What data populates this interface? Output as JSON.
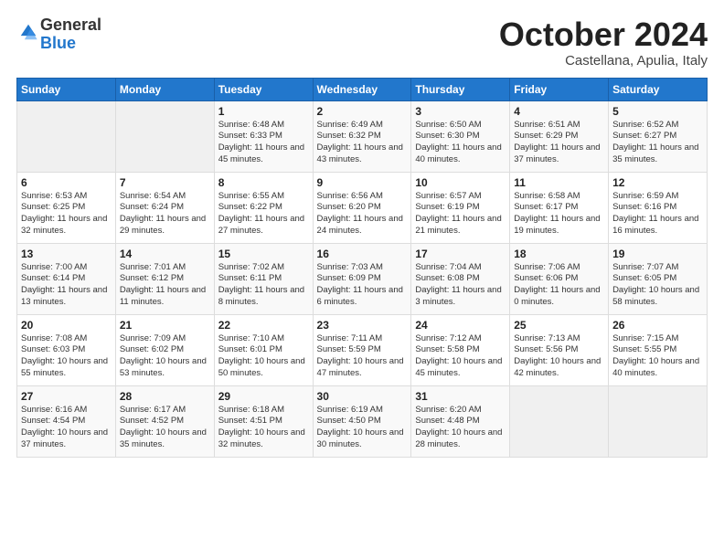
{
  "logo": {
    "general": "General",
    "blue": "Blue"
  },
  "title": "October 2024",
  "subtitle": "Castellana, Apulia, Italy",
  "header_days": [
    "Sunday",
    "Monday",
    "Tuesday",
    "Wednesday",
    "Thursday",
    "Friday",
    "Saturday"
  ],
  "weeks": [
    [
      {
        "day": "",
        "info": ""
      },
      {
        "day": "",
        "info": ""
      },
      {
        "day": "1",
        "info": "Sunrise: 6:48 AM\nSunset: 6:33 PM\nDaylight: 11 hours and 45 minutes."
      },
      {
        "day": "2",
        "info": "Sunrise: 6:49 AM\nSunset: 6:32 PM\nDaylight: 11 hours and 43 minutes."
      },
      {
        "day": "3",
        "info": "Sunrise: 6:50 AM\nSunset: 6:30 PM\nDaylight: 11 hours and 40 minutes."
      },
      {
        "day": "4",
        "info": "Sunrise: 6:51 AM\nSunset: 6:29 PM\nDaylight: 11 hours and 37 minutes."
      },
      {
        "day": "5",
        "info": "Sunrise: 6:52 AM\nSunset: 6:27 PM\nDaylight: 11 hours and 35 minutes."
      }
    ],
    [
      {
        "day": "6",
        "info": "Sunrise: 6:53 AM\nSunset: 6:25 PM\nDaylight: 11 hours and 32 minutes."
      },
      {
        "day": "7",
        "info": "Sunrise: 6:54 AM\nSunset: 6:24 PM\nDaylight: 11 hours and 29 minutes."
      },
      {
        "day": "8",
        "info": "Sunrise: 6:55 AM\nSunset: 6:22 PM\nDaylight: 11 hours and 27 minutes."
      },
      {
        "day": "9",
        "info": "Sunrise: 6:56 AM\nSunset: 6:20 PM\nDaylight: 11 hours and 24 minutes."
      },
      {
        "day": "10",
        "info": "Sunrise: 6:57 AM\nSunset: 6:19 PM\nDaylight: 11 hours and 21 minutes."
      },
      {
        "day": "11",
        "info": "Sunrise: 6:58 AM\nSunset: 6:17 PM\nDaylight: 11 hours and 19 minutes."
      },
      {
        "day": "12",
        "info": "Sunrise: 6:59 AM\nSunset: 6:16 PM\nDaylight: 11 hours and 16 minutes."
      }
    ],
    [
      {
        "day": "13",
        "info": "Sunrise: 7:00 AM\nSunset: 6:14 PM\nDaylight: 11 hours and 13 minutes."
      },
      {
        "day": "14",
        "info": "Sunrise: 7:01 AM\nSunset: 6:12 PM\nDaylight: 11 hours and 11 minutes."
      },
      {
        "day": "15",
        "info": "Sunrise: 7:02 AM\nSunset: 6:11 PM\nDaylight: 11 hours and 8 minutes."
      },
      {
        "day": "16",
        "info": "Sunrise: 7:03 AM\nSunset: 6:09 PM\nDaylight: 11 hours and 6 minutes."
      },
      {
        "day": "17",
        "info": "Sunrise: 7:04 AM\nSunset: 6:08 PM\nDaylight: 11 hours and 3 minutes."
      },
      {
        "day": "18",
        "info": "Sunrise: 7:06 AM\nSunset: 6:06 PM\nDaylight: 11 hours and 0 minutes."
      },
      {
        "day": "19",
        "info": "Sunrise: 7:07 AM\nSunset: 6:05 PM\nDaylight: 10 hours and 58 minutes."
      }
    ],
    [
      {
        "day": "20",
        "info": "Sunrise: 7:08 AM\nSunset: 6:03 PM\nDaylight: 10 hours and 55 minutes."
      },
      {
        "day": "21",
        "info": "Sunrise: 7:09 AM\nSunset: 6:02 PM\nDaylight: 10 hours and 53 minutes."
      },
      {
        "day": "22",
        "info": "Sunrise: 7:10 AM\nSunset: 6:01 PM\nDaylight: 10 hours and 50 minutes."
      },
      {
        "day": "23",
        "info": "Sunrise: 7:11 AM\nSunset: 5:59 PM\nDaylight: 10 hours and 47 minutes."
      },
      {
        "day": "24",
        "info": "Sunrise: 7:12 AM\nSunset: 5:58 PM\nDaylight: 10 hours and 45 minutes."
      },
      {
        "day": "25",
        "info": "Sunrise: 7:13 AM\nSunset: 5:56 PM\nDaylight: 10 hours and 42 minutes."
      },
      {
        "day": "26",
        "info": "Sunrise: 7:15 AM\nSunset: 5:55 PM\nDaylight: 10 hours and 40 minutes."
      }
    ],
    [
      {
        "day": "27",
        "info": "Sunrise: 6:16 AM\nSunset: 4:54 PM\nDaylight: 10 hours and 37 minutes."
      },
      {
        "day": "28",
        "info": "Sunrise: 6:17 AM\nSunset: 4:52 PM\nDaylight: 10 hours and 35 minutes."
      },
      {
        "day": "29",
        "info": "Sunrise: 6:18 AM\nSunset: 4:51 PM\nDaylight: 10 hours and 32 minutes."
      },
      {
        "day": "30",
        "info": "Sunrise: 6:19 AM\nSunset: 4:50 PM\nDaylight: 10 hours and 30 minutes."
      },
      {
        "day": "31",
        "info": "Sunrise: 6:20 AM\nSunset: 4:48 PM\nDaylight: 10 hours and 28 minutes."
      },
      {
        "day": "",
        "info": ""
      },
      {
        "day": "",
        "info": ""
      }
    ]
  ]
}
